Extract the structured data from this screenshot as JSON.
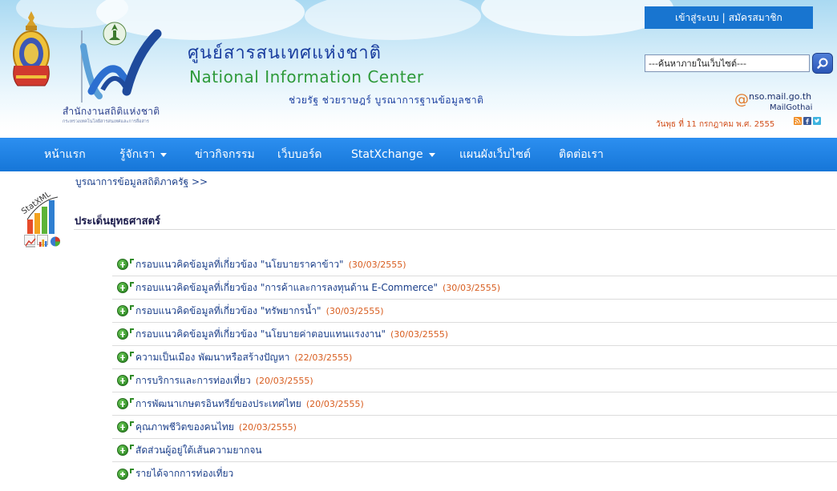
{
  "header": {
    "agency_name_th": "สำนักงานสถิติแห่งชาติ",
    "agency_subtitle_th": "กระทรวงเทคโนโลยีสารสนเทศและการสื่อสาร",
    "center_name_th": "ศูนย์สารสนเทศแห่งชาติ",
    "center_name_en": "National Information Center",
    "slogan_th": "ช่วยรัฐ ช่วยราษฎร์ บูรณาการฐานข้อมูลชาติ",
    "login_label": "เข้าสู่ระบบ",
    "login_separator": "|",
    "register_label": "สมัครสมาชิก",
    "search_value": "---ค้นหาภายในเว็บไซต์---",
    "mail_at": "@",
    "mail_domain": "nso.mail.go.th",
    "mail_name": "MailGothai",
    "date_text": "วันพุธ ที่ 11 กรกฎาคม พ.ศ. 2555"
  },
  "nav": {
    "items": [
      {
        "label": "หน้าแรก",
        "dropdown": false
      },
      {
        "label": "รู้จักเรา",
        "dropdown": true
      },
      {
        "label": "ข่าวกิจกรรม",
        "dropdown": false
      },
      {
        "label": "เว็บบอร์ด",
        "dropdown": false
      },
      {
        "label": "StatXchange",
        "dropdown": true
      },
      {
        "label": "แผนผังเว็บไซต์",
        "dropdown": false
      },
      {
        "label": "ติดต่อเรา",
        "dropdown": false
      }
    ]
  },
  "content": {
    "breadcrumb": "บูรณาการข้อมูลสถิติภาครัฐ >>",
    "logo_text": "StatXML",
    "section_title": "ประเด็นยุทธศาสตร์",
    "items": [
      {
        "title": "กรอบแนวคิดข้อมูลที่เกี่ยวข้อง \"นโยบายราคาข้าว\"",
        "date": "(30/03/2555)"
      },
      {
        "title": "กรอบแนวคิดข้อมูลที่เกี่ยวข้อง \"การค้าและการลงทุนด้าน E-Commerce\"",
        "date": "(30/03/2555)"
      },
      {
        "title": "กรอบแนวคิดข้อมูลที่เกี่ยวข้อง \"ทรัพยากรน้ำ\"",
        "date": "(30/03/2555)"
      },
      {
        "title": "กรอบแนวคิดข้อมูลที่เกี่ยวข้อง \"นโยบายค่าตอบแทนแรงงาน\"",
        "date": "(30/03/2555)"
      },
      {
        "title": "ความเป็นเมือง พัฒนาหรือสร้างปัญหา",
        "date": "(22/03/2555)"
      },
      {
        "title": "การบริการและการท่องเที่ยว",
        "date": "(20/03/2555)"
      },
      {
        "title": "การพัฒนาเกษตรอินทรีย์ของประเทศไทย",
        "date": "(20/03/2555)"
      },
      {
        "title": "คุณภาพชีวิตของคนไทย",
        "date": "(20/03/2555)"
      },
      {
        "title": "สัดส่วนผู้อยู่ใต้เส้นความยากจน",
        "date": ""
      },
      {
        "title": "รายได้จากการท่องเที่ยว",
        "date": ""
      }
    ]
  },
  "colors": {
    "nav_blue": "#1676d8",
    "link_blue": "#1b3f8a",
    "date_orange": "#d85d1f",
    "plus_green": "#2f8a26"
  },
  "icons": [
    "royal-seal-icon",
    "nso-logo-icon",
    "search-icon",
    "rss-icon",
    "facebook-icon",
    "twitter-icon",
    "line-chart-icon",
    "bar-chart-icon",
    "pie-chart-icon",
    "plus-circle-icon"
  ]
}
